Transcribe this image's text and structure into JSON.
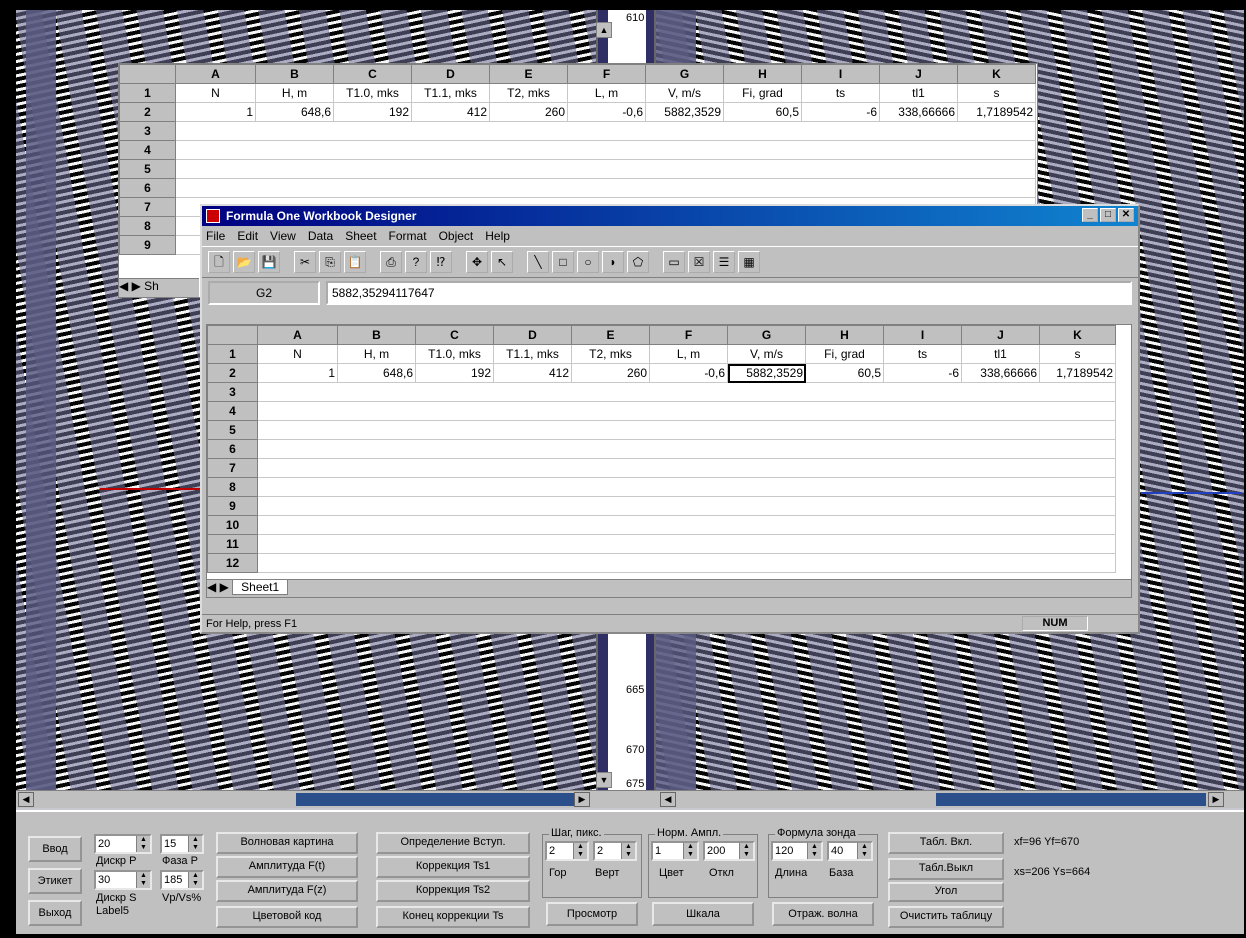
{
  "depth_scale": {
    "labels": [
      "610",
      "665",
      "670",
      "675"
    ]
  },
  "back_sheet": {
    "columns": [
      "A",
      "B",
      "C",
      "D",
      "E",
      "F",
      "G",
      "H",
      "I",
      "J",
      "K"
    ],
    "row_numbers": [
      "1",
      "2",
      "3",
      "4",
      "5",
      "6",
      "7",
      "8",
      "9"
    ],
    "row1": [
      "N",
      "H, m",
      "T1.0, mks",
      "T1.1, mks",
      "T2, mks",
      "L, m",
      "V, m/s",
      "Fi, grad",
      "ts",
      "tl1",
      "s"
    ],
    "row2": [
      "1",
      "648,6",
      "192",
      "412",
      "260",
      "-0,6",
      "5882,3529",
      "60,5",
      "-6",
      "338,66666",
      "1,7189542"
    ],
    "tab": "Sh"
  },
  "window": {
    "title": "Formula One Workbook Designer",
    "menu": [
      "File",
      "Edit",
      "View",
      "Data",
      "Sheet",
      "Format",
      "Object",
      "Help"
    ],
    "cell_ref": "G2",
    "formula_value": "5882,35294117647",
    "columns": [
      "A",
      "B",
      "C",
      "D",
      "E",
      "F",
      "G",
      "H",
      "I",
      "J",
      "K"
    ],
    "row_numbers": [
      "1",
      "2",
      "3",
      "4",
      "5",
      "6",
      "7",
      "8",
      "9",
      "10",
      "11",
      "12"
    ],
    "row1": [
      "N",
      "H, m",
      "T1.0, mks",
      "T1.1, mks",
      "T2, mks",
      "L, m",
      "V, m/s",
      "Fi, grad",
      "ts",
      "tl1",
      "s"
    ],
    "row2": [
      "1",
      "648,6",
      "192",
      "412",
      "260",
      "-0,6",
      "5882,3529",
      "60,5",
      "-6",
      "338,66666",
      "1,7189542"
    ],
    "sheet_tab": "Sheet1",
    "status_help": "For Help, press F1",
    "status_num": "NUM"
  },
  "panel": {
    "vvod": "Ввод",
    "etiket": "Этикет",
    "vyhod": "Выход",
    "diskr_p_value": "20",
    "diskr_p_label": "Дискр P",
    "faza_p_value": "15",
    "faza_p_label": "Фаза P",
    "diskr_s_value": "30",
    "diskr_s_label": "Дискр S",
    "label5": "Label5",
    "vp_vs_value": "185",
    "vp_vs_label": "Vp/Vs%",
    "volnovaya": "Волновая картина",
    "amp_ft": "Амплитуда F(t)",
    "amp_fz": "Амплитуда F(z)",
    "cvet_kod": "Цветовой код",
    "opred_vstup": "Определение Вступ.",
    "korr_ts1": "Коррекция  Ts1",
    "korr_ts2": "Коррекция  Ts2",
    "konec_korr": "Конец коррекции Ts",
    "shag_caption": "Шаг, пикс.",
    "shag_gor_value": "2",
    "shag_vert_value": "2",
    "gor_label": "Гор",
    "vert_label": "Верт",
    "prosmotr": "Просмотр",
    "norm_caption": "Норм. Ампл.",
    "norm_cvet_value": "1",
    "norm_otkl_value": "200",
    "cvet_label": "Цвет",
    "otkl_label": "Откл",
    "shkala": "Шкала",
    "formula_caption": "Формула зонда",
    "dlina_value": "120",
    "baza_value": "40",
    "dlina_label": "Длина",
    "baza_label": "База",
    "otraj": "Отраж. волна",
    "tabl_vkl": "Табл. Вкл.",
    "tabl_vykl": "Табл.Выкл",
    "ugol": "Угол",
    "clear_table": "Очистить таблицу",
    "coord1": "xf=96  Yf=670",
    "coord2": "xs=206  Ys=664"
  }
}
